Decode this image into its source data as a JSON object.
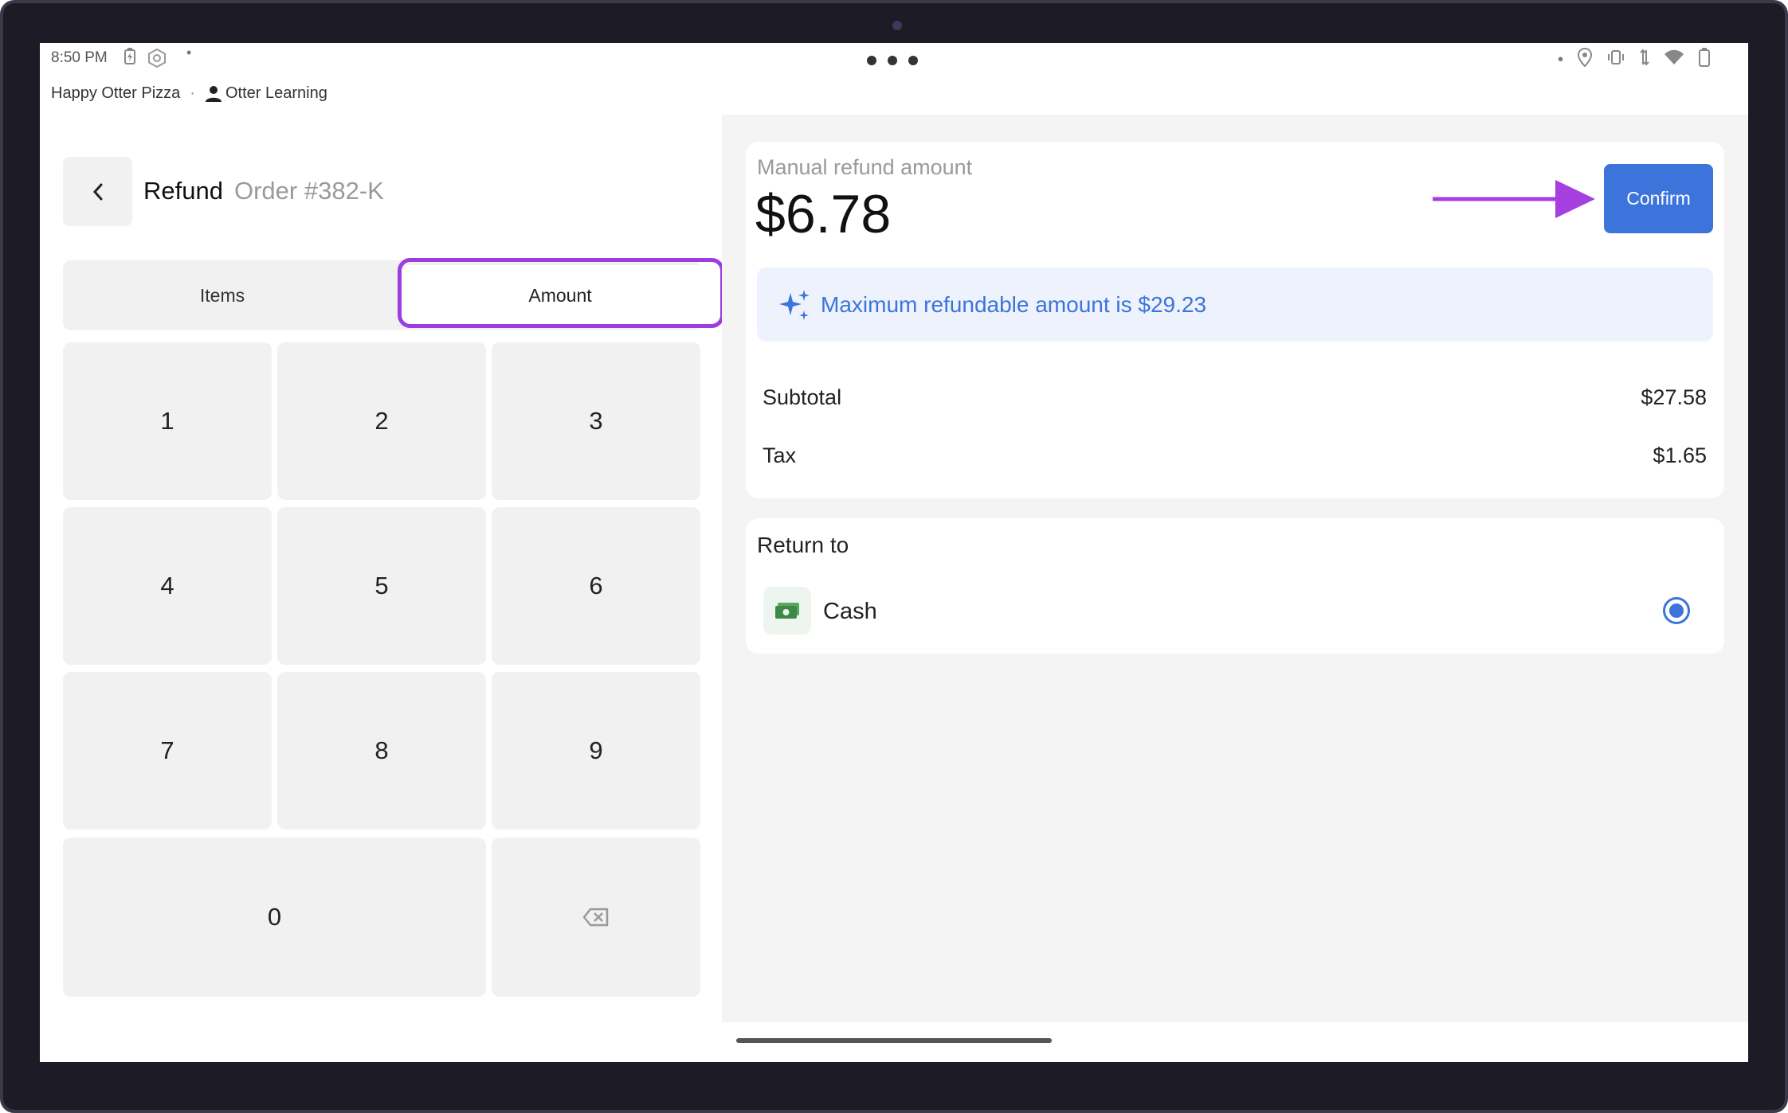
{
  "status_bar": {
    "time": "8:50 PM",
    "icons_left": [
      "battery-saver-icon",
      "app-icon",
      "dot-icon"
    ],
    "icons_right": [
      "dot-icon",
      "location-icon",
      "vibrate-icon",
      "data-icon",
      "wifi-icon",
      "battery-icon"
    ]
  },
  "merchant": {
    "store_name": "Happy Otter Pizza",
    "separator": "·",
    "user_name": "Otter Learning"
  },
  "header": {
    "back_icon": "chevron-left-icon",
    "title": "Refund",
    "order": "Order #382-K"
  },
  "tabs": {
    "items_label": "Items",
    "amount_label": "Amount",
    "selected": "Amount"
  },
  "keypad": {
    "keys": [
      "1",
      "2",
      "3",
      "4",
      "5",
      "6",
      "7",
      "8",
      "9",
      "0"
    ],
    "backspace_icon": "backspace-icon"
  },
  "refund": {
    "label": "Manual refund amount",
    "amount": "$6.78",
    "confirm_label": "Confirm",
    "info_text": "Maximum refundable amount is $29.23",
    "subtotal_label": "Subtotal",
    "subtotal_value": "$27.58",
    "tax_label": "Tax",
    "tax_value": "$1.65"
  },
  "return_to": {
    "label": "Return to",
    "method": "Cash",
    "selected": true
  },
  "colors": {
    "accent": "#3c74dc",
    "highlight": "#9d3de0",
    "bezel": "#1c1b26"
  }
}
